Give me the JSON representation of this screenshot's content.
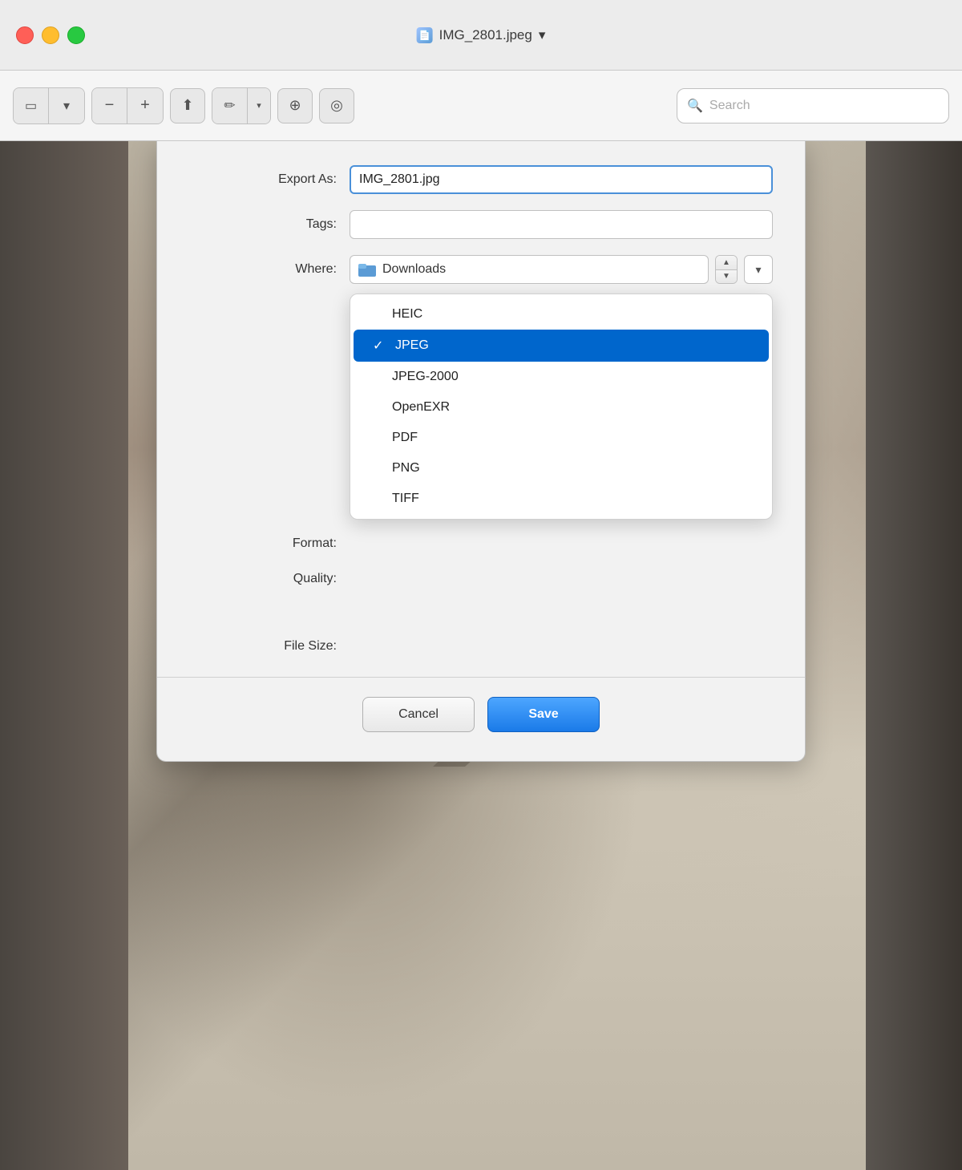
{
  "titlebar": {
    "title": "IMG_2801.jpeg",
    "chevron": "▾",
    "icon_label": "jpeg"
  },
  "toolbar": {
    "sidebar_toggle": "⊞",
    "zoom_out": "−",
    "zoom_in": "+",
    "share": "↑",
    "annotate": "✏",
    "annotate_chevron": "▾",
    "stamp": "⊕",
    "markup": "◎",
    "search_placeholder": "Search"
  },
  "dialog": {
    "export_as_label": "Export As:",
    "export_as_value": "IMG_2801.jpg",
    "tags_label": "Tags:",
    "tags_value": "",
    "where_label": "Where:",
    "where_value": "Downloads",
    "format_label": "Format:",
    "quality_label": "Quality:",
    "file_size_label": "File Size:",
    "cancel_label": "Cancel",
    "save_label": "Save"
  },
  "dropdown": {
    "items": [
      {
        "label": "HEIC",
        "checked": false
      },
      {
        "label": "JPEG",
        "checked": true
      },
      {
        "label": "JPEG-2000",
        "checked": false
      },
      {
        "label": "OpenEXR",
        "checked": false
      },
      {
        "label": "PDF",
        "checked": false
      },
      {
        "label": "PNG",
        "checked": false
      },
      {
        "label": "TIFF",
        "checked": false
      }
    ]
  },
  "colors": {
    "accent_blue": "#1a7ae8",
    "traffic_close": "#ff5f57",
    "traffic_minimize": "#ffbd2e",
    "traffic_maximize": "#28c941"
  }
}
